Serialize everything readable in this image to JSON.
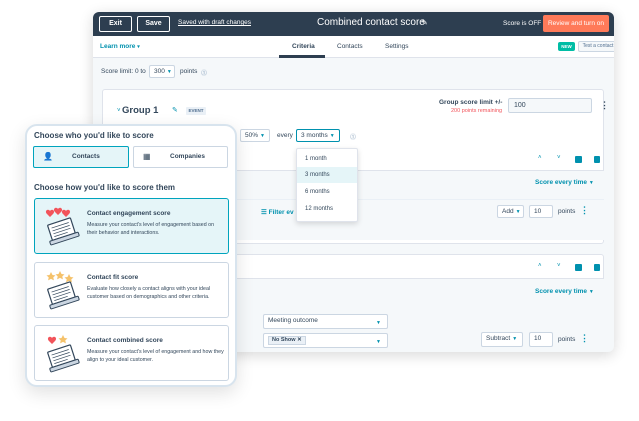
{
  "topbar": {
    "exit_label": "Exit",
    "save_label": "Save",
    "saved_link": "Saved with draft changes",
    "title": "Combined contact score",
    "score_status": "Score is OFF",
    "review_button": "Review and turn on"
  },
  "tabbar": {
    "learn_more": "Learn more",
    "tabs": [
      {
        "label": "Criteria",
        "active": true
      },
      {
        "label": "Contacts",
        "active": false
      },
      {
        "label": "Settings",
        "active": false
      }
    ],
    "new_badge": "NEW",
    "test_contact": "Test a contact"
  },
  "score_limit": {
    "label": "Score limit: 0 to",
    "value": "300",
    "suffix": "points"
  },
  "group": {
    "title": "Group 1",
    "badge": "EVENT",
    "limit_label": "Group score limit +/-",
    "remaining": "200 points remaining",
    "limit_value": "100",
    "decay_percent": "50%",
    "every_label": "every",
    "period_value": "3 months",
    "score_every_1": "Score every time",
    "filter_label": "Filter ev",
    "action_1": "Add",
    "points_1": "10",
    "points_label": "points",
    "score_every_2": "Score every time",
    "meeting_outcome": "Meeting outcome",
    "tag_no_show": "No Show",
    "action_2": "Subtract",
    "points_2": "10"
  },
  "period_dropdown": {
    "options": [
      "1 month",
      "3 months",
      "6 months",
      "12 months"
    ],
    "selected": "3 months"
  },
  "panel": {
    "heading_who": "Choose who you'd like to score",
    "contacts_label": "Contacts",
    "companies_label": "Companies",
    "heading_how": "Choose how you'd like to score them",
    "options": [
      {
        "title": "Contact engagement score",
        "desc": "Measure your contact's level of engagement based on their behavior and interactions.",
        "active": true
      },
      {
        "title": "Contact fit score",
        "desc": "Evaluate how closely a contact aligns with your ideal customer based on demographics and other criteria.",
        "active": false
      },
      {
        "title": "Contact combined score",
        "desc": "Measure your contact's level of engagement and how they align to your ideal customer.",
        "active": false
      }
    ]
  },
  "colors": {
    "topbar": "#2d3e50",
    "accent_orange": "#ff7a59",
    "teal": "#0091ae",
    "selected_bg": "#e5f5f8",
    "warning_red": "#f2545b"
  }
}
